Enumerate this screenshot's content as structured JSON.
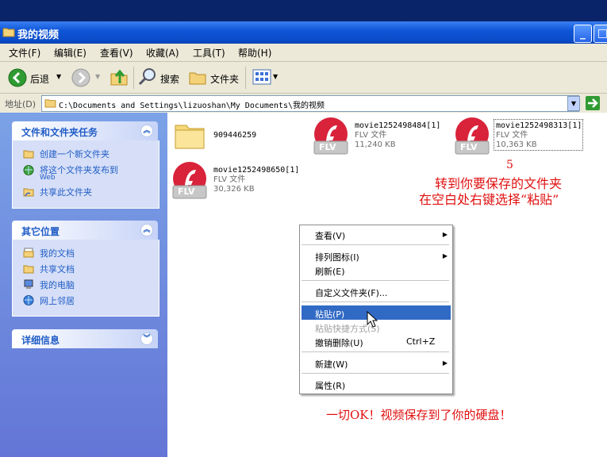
{
  "window": {
    "title": "我的视频"
  },
  "menu": [
    "文件(F)",
    "编辑(E)",
    "查看(V)",
    "收藏(A)",
    "工具(T)",
    "帮助(H)"
  ],
  "toolbar": {
    "back": "后退",
    "search": "搜索",
    "folders": "文件夹"
  },
  "address": {
    "label": "地址(D)",
    "path": "C:\\Documents and Settings\\lizuoshan\\My Documents\\我的视频"
  },
  "sidebar": {
    "tasks": {
      "title": "文件和文件夹任务",
      "items": [
        "创建一个新文件夹",
        "将这个文件夹发布到",
        "Web",
        "共享此文件夹"
      ]
    },
    "places": {
      "title": "其它位置",
      "items": [
        "我的文档",
        "共享文档",
        "我的电脑",
        "网上邻居"
      ]
    },
    "details": {
      "title": "详细信息"
    }
  },
  "files": [
    {
      "name": "909446259",
      "type": "",
      "size": ""
    },
    {
      "name": "movie1252498484[1]",
      "type": "FLV 文件",
      "size": "11,240 KB"
    },
    {
      "name": "movie1252498313[1]",
      "type": "FLV 文件",
      "size": "10,363 KB"
    },
    {
      "name": "movie1252498650[1]",
      "type": "FLV 文件",
      "size": "30,326 KB"
    }
  ],
  "flv_badge": "FLV",
  "context_menu": {
    "view": "查看(V)",
    "arrange": "排列图标(I)",
    "refresh": "刷新(E)",
    "customize": "自定义文件夹(F)...",
    "paste": "粘贴(P)",
    "paste_shortcut": "粘贴快捷方式(S)",
    "undo": "撤销删除(U)",
    "undo_shortcut": "Ctrl+Z",
    "new": "新建(W)",
    "properties": "属性(R)"
  },
  "annotations": {
    "step": "5",
    "line1": "转到你要保存的文件夹",
    "line2": "在空白处右键选择“粘贴”",
    "bottom": "一切OK！视频保存到了你的硬盘！"
  },
  "colors": {
    "title_bar": "#0f56d8",
    "sidebar": "#7ba2e7",
    "highlight": "#316ac5",
    "annotation": "#e01010"
  }
}
